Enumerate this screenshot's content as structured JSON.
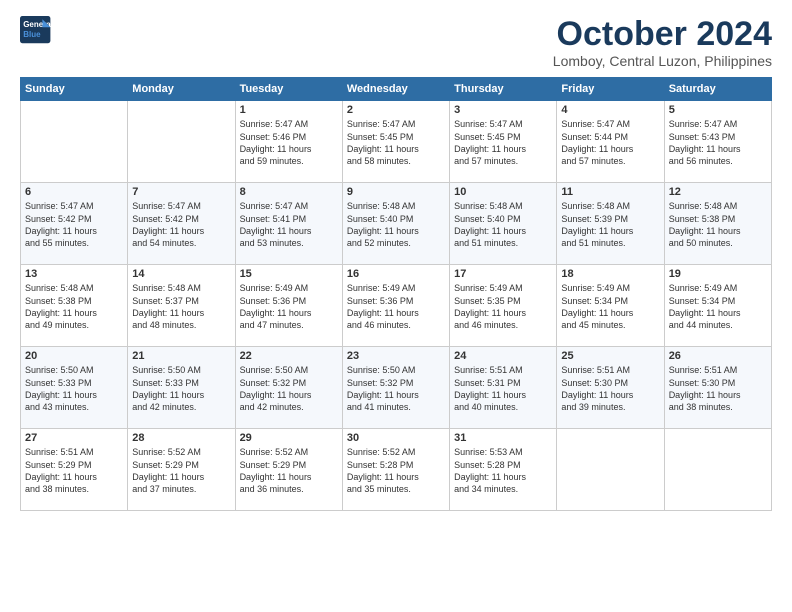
{
  "header": {
    "logo_line1": "General",
    "logo_line2": "Blue",
    "month": "October 2024",
    "location": "Lomboy, Central Luzon, Philippines"
  },
  "weekdays": [
    "Sunday",
    "Monday",
    "Tuesday",
    "Wednesday",
    "Thursday",
    "Friday",
    "Saturday"
  ],
  "weeks": [
    [
      {
        "day": "",
        "info": ""
      },
      {
        "day": "",
        "info": ""
      },
      {
        "day": "1",
        "info": "Sunrise: 5:47 AM\nSunset: 5:46 PM\nDaylight: 11 hours\nand 59 minutes."
      },
      {
        "day": "2",
        "info": "Sunrise: 5:47 AM\nSunset: 5:45 PM\nDaylight: 11 hours\nand 58 minutes."
      },
      {
        "day": "3",
        "info": "Sunrise: 5:47 AM\nSunset: 5:45 PM\nDaylight: 11 hours\nand 57 minutes."
      },
      {
        "day": "4",
        "info": "Sunrise: 5:47 AM\nSunset: 5:44 PM\nDaylight: 11 hours\nand 57 minutes."
      },
      {
        "day": "5",
        "info": "Sunrise: 5:47 AM\nSunset: 5:43 PM\nDaylight: 11 hours\nand 56 minutes."
      }
    ],
    [
      {
        "day": "6",
        "info": "Sunrise: 5:47 AM\nSunset: 5:42 PM\nDaylight: 11 hours\nand 55 minutes."
      },
      {
        "day": "7",
        "info": "Sunrise: 5:47 AM\nSunset: 5:42 PM\nDaylight: 11 hours\nand 54 minutes."
      },
      {
        "day": "8",
        "info": "Sunrise: 5:47 AM\nSunset: 5:41 PM\nDaylight: 11 hours\nand 53 minutes."
      },
      {
        "day": "9",
        "info": "Sunrise: 5:48 AM\nSunset: 5:40 PM\nDaylight: 11 hours\nand 52 minutes."
      },
      {
        "day": "10",
        "info": "Sunrise: 5:48 AM\nSunset: 5:40 PM\nDaylight: 11 hours\nand 51 minutes."
      },
      {
        "day": "11",
        "info": "Sunrise: 5:48 AM\nSunset: 5:39 PM\nDaylight: 11 hours\nand 51 minutes."
      },
      {
        "day": "12",
        "info": "Sunrise: 5:48 AM\nSunset: 5:38 PM\nDaylight: 11 hours\nand 50 minutes."
      }
    ],
    [
      {
        "day": "13",
        "info": "Sunrise: 5:48 AM\nSunset: 5:38 PM\nDaylight: 11 hours\nand 49 minutes."
      },
      {
        "day": "14",
        "info": "Sunrise: 5:48 AM\nSunset: 5:37 PM\nDaylight: 11 hours\nand 48 minutes."
      },
      {
        "day": "15",
        "info": "Sunrise: 5:49 AM\nSunset: 5:36 PM\nDaylight: 11 hours\nand 47 minutes."
      },
      {
        "day": "16",
        "info": "Sunrise: 5:49 AM\nSunset: 5:36 PM\nDaylight: 11 hours\nand 46 minutes."
      },
      {
        "day": "17",
        "info": "Sunrise: 5:49 AM\nSunset: 5:35 PM\nDaylight: 11 hours\nand 46 minutes."
      },
      {
        "day": "18",
        "info": "Sunrise: 5:49 AM\nSunset: 5:34 PM\nDaylight: 11 hours\nand 45 minutes."
      },
      {
        "day": "19",
        "info": "Sunrise: 5:49 AM\nSunset: 5:34 PM\nDaylight: 11 hours\nand 44 minutes."
      }
    ],
    [
      {
        "day": "20",
        "info": "Sunrise: 5:50 AM\nSunset: 5:33 PM\nDaylight: 11 hours\nand 43 minutes."
      },
      {
        "day": "21",
        "info": "Sunrise: 5:50 AM\nSunset: 5:33 PM\nDaylight: 11 hours\nand 42 minutes."
      },
      {
        "day": "22",
        "info": "Sunrise: 5:50 AM\nSunset: 5:32 PM\nDaylight: 11 hours\nand 42 minutes."
      },
      {
        "day": "23",
        "info": "Sunrise: 5:50 AM\nSunset: 5:32 PM\nDaylight: 11 hours\nand 41 minutes."
      },
      {
        "day": "24",
        "info": "Sunrise: 5:51 AM\nSunset: 5:31 PM\nDaylight: 11 hours\nand 40 minutes."
      },
      {
        "day": "25",
        "info": "Sunrise: 5:51 AM\nSunset: 5:30 PM\nDaylight: 11 hours\nand 39 minutes."
      },
      {
        "day": "26",
        "info": "Sunrise: 5:51 AM\nSunset: 5:30 PM\nDaylight: 11 hours\nand 38 minutes."
      }
    ],
    [
      {
        "day": "27",
        "info": "Sunrise: 5:51 AM\nSunset: 5:29 PM\nDaylight: 11 hours\nand 38 minutes."
      },
      {
        "day": "28",
        "info": "Sunrise: 5:52 AM\nSunset: 5:29 PM\nDaylight: 11 hours\nand 37 minutes."
      },
      {
        "day": "29",
        "info": "Sunrise: 5:52 AM\nSunset: 5:29 PM\nDaylight: 11 hours\nand 36 minutes."
      },
      {
        "day": "30",
        "info": "Sunrise: 5:52 AM\nSunset: 5:28 PM\nDaylight: 11 hours\nand 35 minutes."
      },
      {
        "day": "31",
        "info": "Sunrise: 5:53 AM\nSunset: 5:28 PM\nDaylight: 11 hours\nand 34 minutes."
      },
      {
        "day": "",
        "info": ""
      },
      {
        "day": "",
        "info": ""
      }
    ]
  ]
}
